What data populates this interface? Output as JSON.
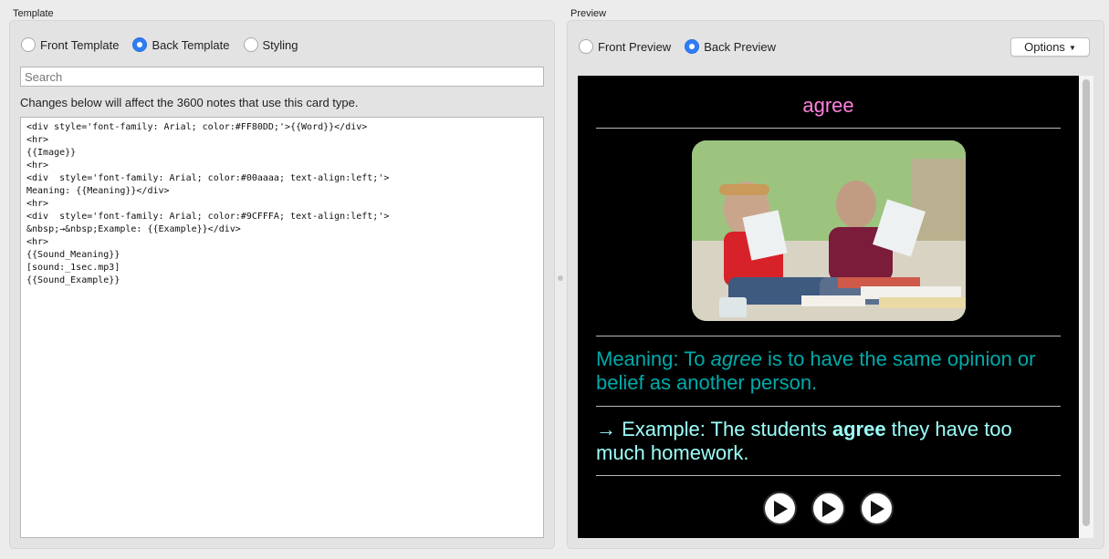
{
  "template": {
    "group_label": "Template",
    "radios": [
      {
        "label": "Front Template",
        "selected": false
      },
      {
        "label": "Back Template",
        "selected": true
      },
      {
        "label": "Styling",
        "selected": false
      }
    ],
    "search_placeholder": "Search",
    "notice": "Changes below will affect the 3600 notes that use this card type.",
    "code": "<div style='font-family: Arial; color:#FF80DD;'>{{Word}}</div>\n<hr>\n{{Image}}\n<hr>\n<div  style='font-family: Arial; color:#00aaaa; text-align:left;'>\nMeaning: {{Meaning}}</div>\n<hr>\n<div  style='font-family: Arial; color:#9CFFFA; text-align:left;'>\n&nbsp;→&nbsp;Example: {{Example}}</div>\n<hr>\n{{Sound_Meaning}}\n[sound:_1sec.mp3]\n{{Sound_Example}}"
  },
  "preview": {
    "group_label": "Preview",
    "radios": [
      {
        "label": "Front Preview",
        "selected": false
      },
      {
        "label": "Back Preview",
        "selected": true
      }
    ],
    "options_label": "Options",
    "card": {
      "word": "agree",
      "meaning_prefix": "Meaning: To ",
      "meaning_em": "agree",
      "meaning_suffix": " is to have the same opinion or belief as another person.",
      "example_prefix": " → Example: The students ",
      "example_bold": "agree",
      "example_suffix": " they have too much homework."
    }
  },
  "colors": {
    "word": "#FF80DD",
    "meaning": "#00aaaa",
    "example": "#9CFFFA",
    "accent": "#2f7df6"
  }
}
